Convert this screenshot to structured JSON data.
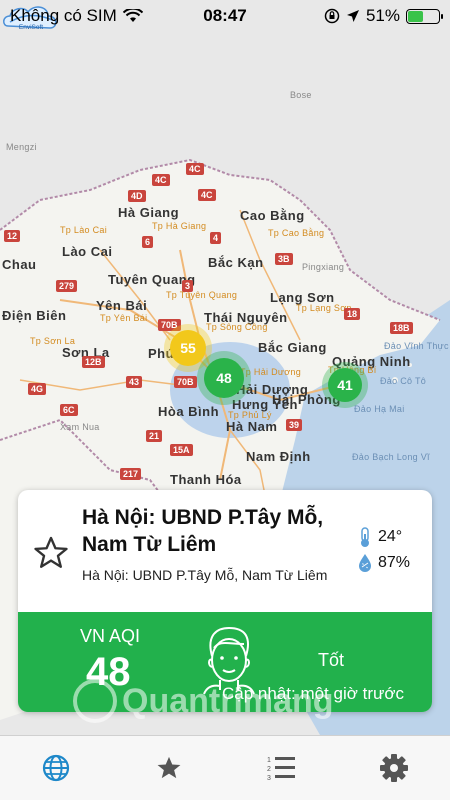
{
  "status_bar": {
    "carrier": "Không có SIM",
    "time": "08:47",
    "battery_percent": "51%",
    "battery_level": 0.51
  },
  "map": {
    "labels": [
      "Mengzi",
      "Bose",
      "Hà Giang",
      "Cao Bằng",
      "Tp Hà Giang",
      "Tp Lào Cai",
      "Lào Cai",
      "Chau",
      "Bắc Kạn",
      "Tp Cao Bằng",
      "Tuyên Quang",
      "Tp Tuyên Quang",
      "Yên Bái",
      "Tp Yên Bái",
      "Lạng Sơn",
      "Tp Lạng Sơn",
      "Pingxiang",
      "Thái Nguyên",
      "Tp Sông Công",
      "Bắc Giang",
      "Sơn La",
      "Tp Sơn La",
      "Phú",
      "Hải Dương",
      "Quảng Ninh",
      "Hưng Yên",
      "Hải Phòng",
      "Hòa Bình",
      "Tp Hải Dương",
      "Hà Nam",
      "Nam Định",
      "Thanh Hóa",
      "Xam Nua",
      "Điện Biên",
      "Tp Phủ Lý",
      "Tp Uông Bí",
      "Đảo Vĩnh Thực",
      "Đảo Cô Tô",
      "Đảo Hạ Mai",
      "Đảo Bạch Long Vĩ"
    ],
    "road_badges": [
      "4C",
      "4C",
      "4C",
      "4D",
      "12",
      "279",
      "4G",
      "6C",
      "70B",
      "43",
      "70B",
      "12B",
      "217",
      "15A",
      "18B",
      "18",
      "39",
      "21",
      "3B",
      "6",
      "4",
      "3"
    ],
    "markers": [
      {
        "value": "55",
        "color": "#f2c81b"
      },
      {
        "value": "48",
        "color": "#2ab34a"
      },
      {
        "value": "41",
        "color": "#2ab34a"
      }
    ],
    "logo_text": "EnviSoft"
  },
  "station_card": {
    "title": "Hà Nội: UBND P.Tây Mỗ, Nam Từ Liêm",
    "subtitle": "Hà Nội: UBND P.Tây Mỗ, Nam Từ Liêm",
    "temperature": "24°",
    "humidity": "87%",
    "aqi_label": "VN AQI",
    "aqi_value": "48",
    "aqi_status": "Tốt",
    "updated": "Cập nhật: một giờ trước",
    "aqi_color": "#22b14c"
  },
  "watermark": "Quantrimang",
  "tabs": [
    "globe-icon",
    "star-icon",
    "list-icon",
    "gear-icon"
  ],
  "colors": {
    "accent": "#1e88c9",
    "tab_inactive": "#555555"
  }
}
